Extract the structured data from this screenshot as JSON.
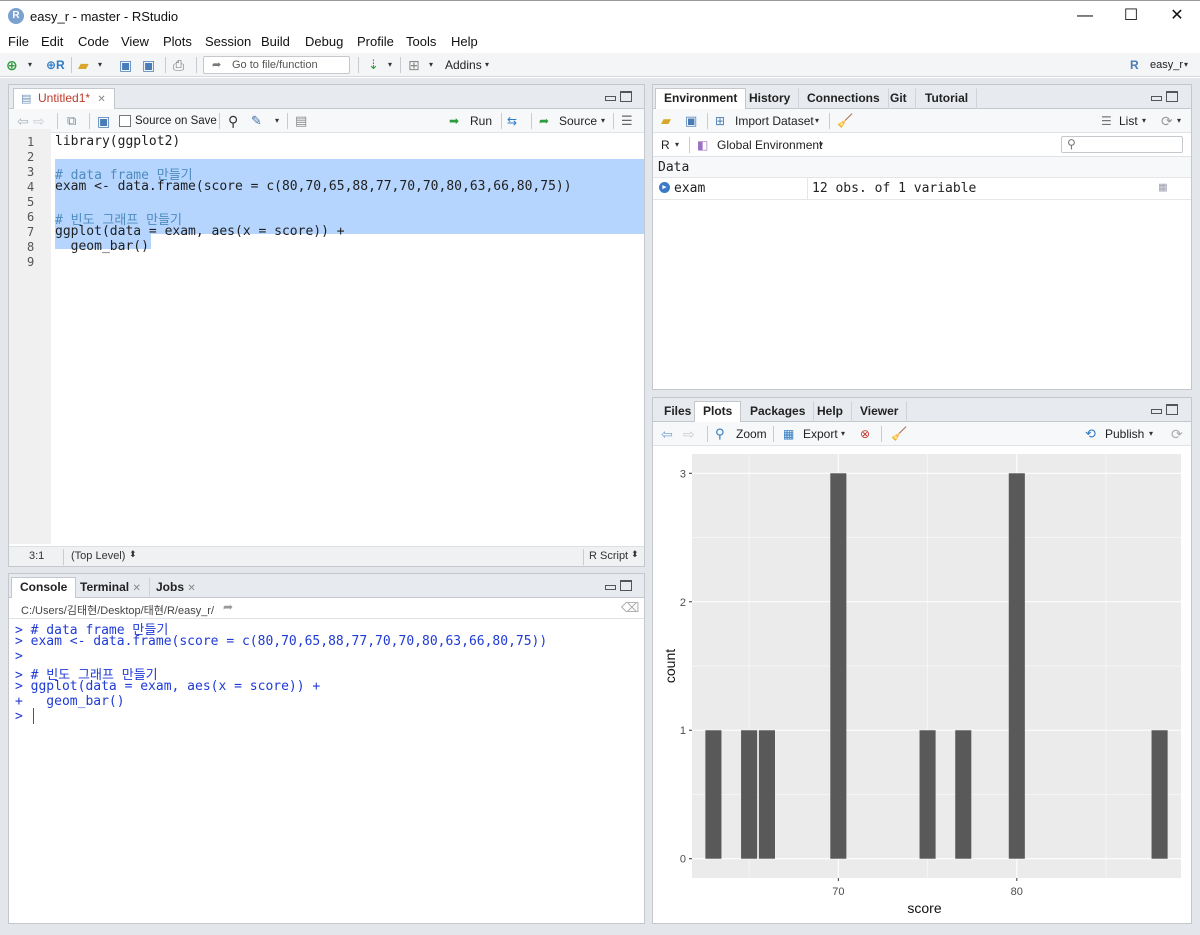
{
  "window": {
    "app_icon": "R",
    "title": "easy_r - master - RStudio",
    "minimize": "—",
    "maximize": "☐",
    "close": "✕"
  },
  "menu": [
    "File",
    "Edit",
    "Code",
    "View",
    "Plots",
    "Session",
    "Build",
    "Debug",
    "Profile",
    "Tools",
    "Help"
  ],
  "toolbar": {
    "goto_placeholder": "Go to file/function",
    "addins_label": "Addins",
    "project_label": "easy_r"
  },
  "editor": {
    "tab_label": "Untitled1*",
    "source_on_save": "Source on Save",
    "run_label": "Run",
    "source_label": "Source",
    "status_position": "3:1",
    "status_scope": "(Top Level)",
    "status_type": "R Script",
    "lines": [
      {
        "n": "1",
        "text": "library(ggplot2)"
      },
      {
        "n": "2",
        "text": ""
      },
      {
        "n": "3",
        "text": "# data frame 만들기"
      },
      {
        "n": "4",
        "text": "exam <- data.frame(score = c(80,70,65,88,77,70,70,80,63,66,80,75))"
      },
      {
        "n": "5",
        "text": ""
      },
      {
        "n": "6",
        "text": "# 빈도 그래프 만들기"
      },
      {
        "n": "7",
        "text": "ggplot(data = exam, aes(x = score)) +"
      },
      {
        "n": "8",
        "text": "  geom_bar()"
      },
      {
        "n": "9",
        "text": ""
      }
    ]
  },
  "console": {
    "tabs": [
      "Console",
      "Terminal",
      "Jobs"
    ],
    "path": "C:/Users/김태현/Desktop/태현/R/easy_r/",
    "lines": [
      "> # data frame 만들기",
      "> exam <- data.frame(score = c(80,70,65,88,77,70,70,80,63,66,80,75))",
      ">",
      "> # 빈도 그래프 만들기",
      "> ggplot(data = exam, aes(x = score)) +",
      "+   geom_bar()",
      "> "
    ]
  },
  "environment": {
    "tabs": [
      "Environment",
      "History",
      "Connections",
      "Git",
      "Tutorial"
    ],
    "import_dataset": "Import Dataset",
    "list_label": "List",
    "r_label": "R",
    "global_env": "Global Environment",
    "section": "Data",
    "rows": [
      {
        "name": "exam",
        "value": "12 obs. of 1 variable"
      }
    ]
  },
  "plots_pane": {
    "tabs": [
      "Files",
      "Plots",
      "Packages",
      "Help",
      "Viewer"
    ],
    "zoom_label": "Zoom",
    "export_label": "Export",
    "publish_label": "Publish"
  },
  "chart_data": {
    "type": "bar",
    "x": [
      63,
      65,
      66,
      70,
      75,
      77,
      80,
      88
    ],
    "values": [
      1,
      1,
      1,
      3,
      1,
      1,
      3,
      1
    ],
    "xlabel": "score",
    "ylabel": "count",
    "xticks": [
      70,
      80
    ],
    "yticks": [
      0,
      1,
      2,
      3
    ],
    "xlim": [
      61.8,
      89.2
    ],
    "ylim": [
      -0.15,
      3.15
    ],
    "bar_width": 0.9,
    "grid": true,
    "colors": {
      "panel": "#ebebeb",
      "bar": "#595959",
      "grid": "#ffffff"
    }
  }
}
